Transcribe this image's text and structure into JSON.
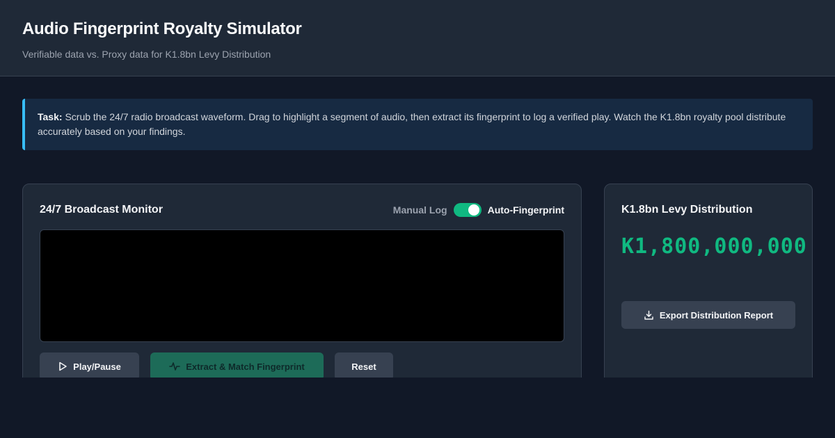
{
  "header": {
    "title": "Audio Fingerprint Royalty Simulator",
    "subtitle": "Verifiable data vs. Proxy data for K1.8bn Levy Distribution"
  },
  "task": {
    "label": "Task:",
    "text": "Scrub the 24/7 radio broadcast waveform. Drag to highlight a segment of audio, then extract its fingerprint to log a verified play. Watch the K1.8bn royalty pool distribute accurately based on your findings."
  },
  "monitor": {
    "title": "24/7 Broadcast Monitor",
    "toggle_off_label": "Manual Log",
    "toggle_on_label": "Auto-Fingerprint",
    "toggle_state": "on",
    "buttons": {
      "play": "Play/Pause",
      "extract": "Extract & Match Fingerprint",
      "reset": "Reset"
    },
    "icons": {
      "play": "play-icon",
      "extract": "activity-pulse-icon"
    }
  },
  "levy": {
    "title": "K1.8bn Levy Distribution",
    "amount": "K1,800,000,000",
    "export_label": "Export Distribution Report",
    "export_icon": "download-icon"
  },
  "colors": {
    "background": "#111827",
    "panel": "#1f2937",
    "accent_green": "#10b981",
    "info_border": "#38bdf8"
  }
}
